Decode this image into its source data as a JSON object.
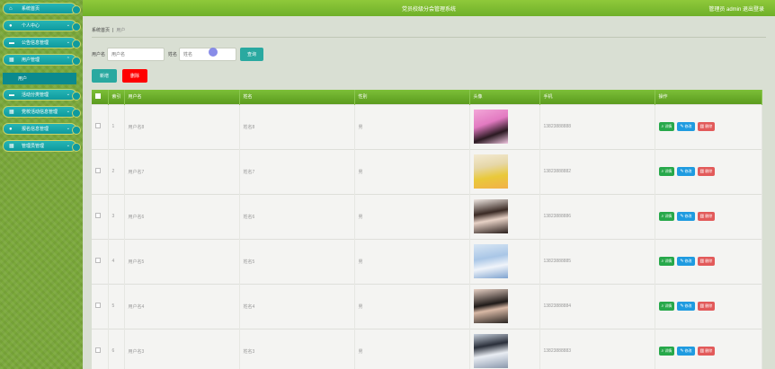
{
  "header": {
    "title": "党员校级分会管理系统",
    "admin_info": "管理员 admin  退出登录"
  },
  "sidebar": {
    "items": [
      {
        "label": "系统首页",
        "icon": "home-icon",
        "glyph": "⌂"
      },
      {
        "label": "个人中心",
        "icon": "user-icon",
        "glyph": "●"
      },
      {
        "label": "公告信息管理",
        "icon": "folder-icon",
        "glyph": "▦"
      },
      {
        "label": "用户管理",
        "icon": "grid-icon",
        "glyph": "▦"
      },
      {
        "label": "活动分类管理",
        "icon": "folder-icon",
        "glyph": "▦"
      },
      {
        "label": "党校活动信息管理",
        "icon": "grid-icon",
        "glyph": "▦"
      },
      {
        "label": "报名信息管理",
        "icon": "user-icon",
        "glyph": "●"
      },
      {
        "label": "管理员管理",
        "icon": "grid-icon",
        "glyph": "▦"
      }
    ],
    "submenu_label": "用户"
  },
  "breadcrumb": {
    "home": "系统首页",
    "separator": "|",
    "current": "用户"
  },
  "search": {
    "username_label": "用户名",
    "username_placeholder": "用户名",
    "name_label": "姓名",
    "name_placeholder": "姓名",
    "search_button": "查询"
  },
  "actions": {
    "add": "新增",
    "delete": "删除"
  },
  "table": {
    "headers": [
      "",
      "索引",
      "用户名",
      "姓名",
      "性别",
      "头像",
      "手机",
      "操作"
    ],
    "rows": [
      {
        "index": "1",
        "username": "用户名8",
        "name": "姓名8",
        "gender": "男",
        "phone": "13823888888"
      },
      {
        "index": "2",
        "username": "用户名7",
        "name": "姓名7",
        "gender": "男",
        "phone": "13823888882"
      },
      {
        "index": "3",
        "username": "用户名6",
        "name": "姓名6",
        "gender": "男",
        "phone": "13823888886"
      },
      {
        "index": "4",
        "username": "用户名5",
        "name": "姓名5",
        "gender": "男",
        "phone": "13823888885"
      },
      {
        "index": "5",
        "username": "用户名4",
        "name": "姓名4",
        "gender": "男",
        "phone": "13823888884"
      },
      {
        "index": "6",
        "username": "用户名3",
        "name": "姓名3",
        "gender": "男",
        "phone": "13823888883"
      }
    ],
    "op_detail": "详情",
    "op_edit": "修改",
    "op_delete": "删除"
  },
  "colors": {
    "accent_green": "#6fb02a",
    "teal": "#0f9a9e",
    "danger": "#ff0000"
  }
}
